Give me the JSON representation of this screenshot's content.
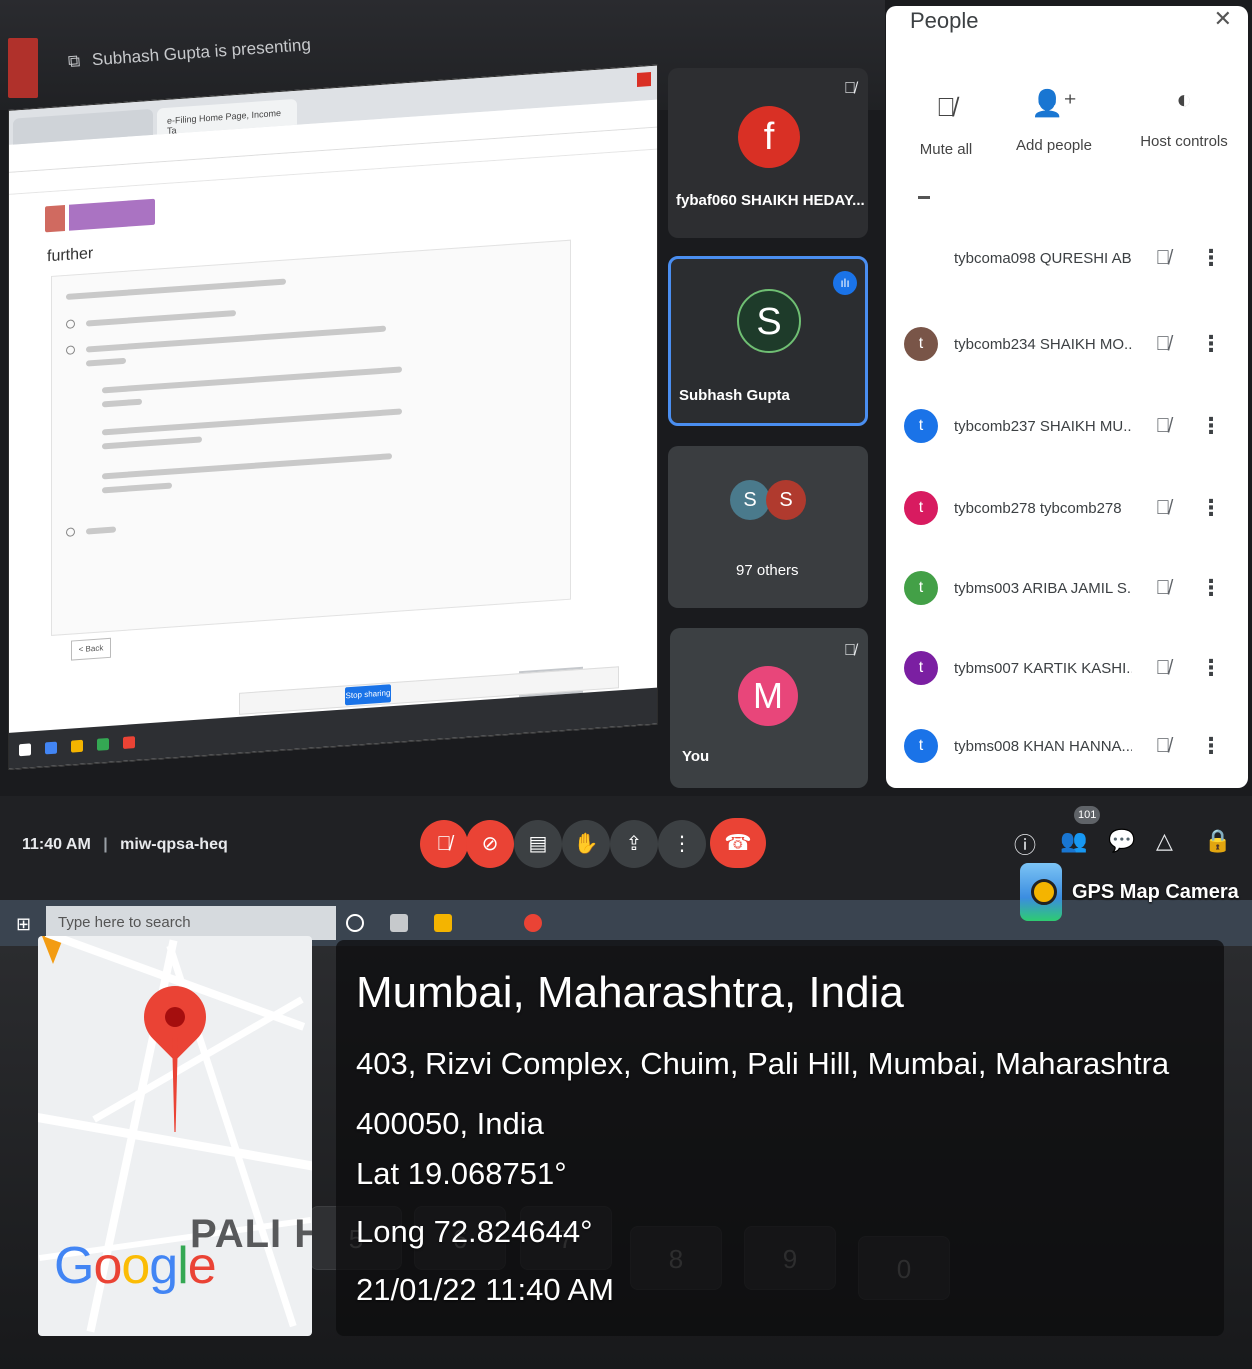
{
  "meet": {
    "presenting_text": "Subhash Gupta is presenting",
    "time": "11:40 AM",
    "meeting_code": "miw-qpsa-heq",
    "participant_badge": "101"
  },
  "shared_screen": {
    "tab_1": "e-Filing Home Page, Income Ta",
    "page_heading": "further",
    "back_label": "< Back",
    "share_button": "Stop sharing"
  },
  "tiles": [
    {
      "initial": "f",
      "name": "fybaf060 SHAIKH HEDAY...",
      "color": "#d93025"
    },
    {
      "initial": "S",
      "name": "Subhash Gupta",
      "color": "#1e3b2a"
    },
    {
      "initial_a": "S",
      "initial_b": "S",
      "name": "97 others",
      "color_a": "#4a7a8c",
      "color_b": "#b03a2e"
    },
    {
      "initial": "M",
      "name": "You",
      "color": "#e8467a"
    }
  ],
  "people_panel": {
    "title": "People",
    "actions": {
      "mute_all": "Mute all",
      "add_people": "Add people",
      "host_controls": "Host controls"
    },
    "participants": [
      {
        "initial": "",
        "name": "tybcoma098 QURESHI AB...",
        "color": "#ffffff"
      },
      {
        "initial": "t",
        "name": "tybcomb234 SHAIKH MO...",
        "color": "#795548"
      },
      {
        "initial": "t",
        "name": "tybcomb237 SHAIKH MU...",
        "color": "#1a73e8"
      },
      {
        "initial": "t",
        "name": "tybcomb278 tybcomb278",
        "color": "#d81b60"
      },
      {
        "initial": "t",
        "name": "tybms003 ARIBA JAMIL S...",
        "color": "#43a047"
      },
      {
        "initial": "t",
        "name": "tybms007 KARTIK KASHI...",
        "color": "#7b1fa2"
      },
      {
        "initial": "t",
        "name": "tybms008 KHAN HANNA...",
        "color": "#1a73e8"
      }
    ]
  },
  "taskbar": {
    "search_placeholder": "Type here to search"
  },
  "gps": {
    "brand": "GPS Map Camera",
    "city": "Mumbai, Maharashtra, India",
    "address": "403, Rizvi Complex, Chuim, Pali Hill, Mumbai, Maharashtra 400050, India",
    "lat": "Lat 19.068751°",
    "long": "Long 72.824644°",
    "datetime": "21/01/22 11:40 AM",
    "map_label": "PALI HIL",
    "google_logo": "Google"
  },
  "keyboard_keys": [
    "5",
    "6",
    "7",
    "8",
    "9",
    "0"
  ]
}
